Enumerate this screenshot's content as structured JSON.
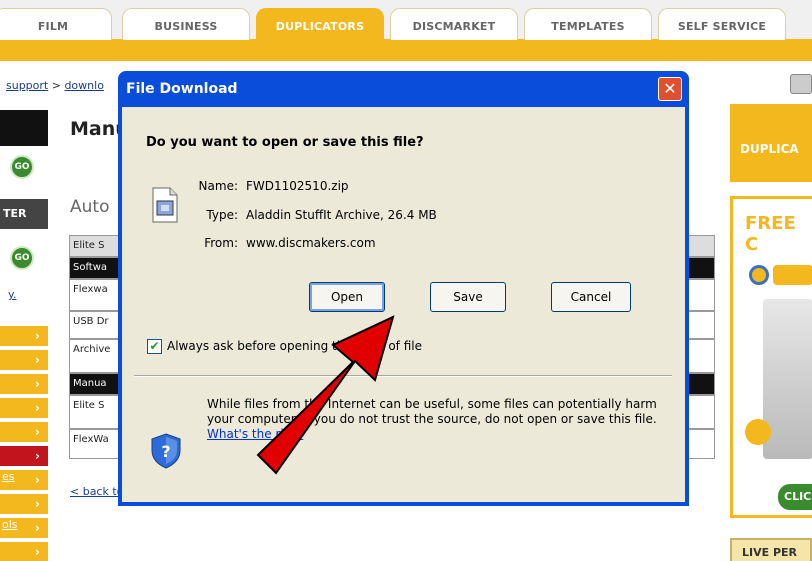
{
  "nav": {
    "tabs": [
      "FILM",
      "BUSINESS",
      "DUPLICATORS",
      "DISCMARKET",
      "TEMPLATES",
      "SELF SERVICE"
    ],
    "active_tab": "DUPLICATORS"
  },
  "breadcrumb": {
    "link1": "support",
    "sep": ">",
    "link2": "downlo"
  },
  "left_nav": {
    "go_label": "GO",
    "gray_label": "TER",
    "link_y": "y.",
    "link_es": "es",
    "link_ols": "ols",
    "arrow": "›"
  },
  "page": {
    "title": "Manu",
    "section": "Auto",
    "rows": [
      "Elite S",
      "Softwa",
      "Flexwa",
      "USB Dr",
      "Archive",
      "Manua",
      "Elite S",
      "FlexWa"
    ],
    "back_link": "< back to downloads main page"
  },
  "right": {
    "dup": "DUPLICA",
    "free": "FREE C",
    "click": "CLIC",
    "live": "LIVE PER"
  },
  "dialog": {
    "title": "File Download",
    "close": "✕",
    "question": "Do you want to open or save this file?",
    "name_label": "Name:",
    "name_value": "FWD1102510.zip",
    "type_label": "Type:",
    "type_value": "Aladdin StuffIt Archive, 26.4 MB",
    "from_label": "From:",
    "from_value": "www.discmakers.com",
    "open": "Open",
    "save": "Save",
    "cancel": "Cancel",
    "always_ask": "Always ask before opening this type of file",
    "always_ask_checked": true,
    "warning": "While files from the Internet can be useful, some files can potentially harm your computer. If you do not trust the source, do not open or save this file.",
    "risk_link": "What's the risk?"
  },
  "colors": {
    "accent": "#f3b81e",
    "dialog_title": "#0a4ddb",
    "dialog_body": "#ece9d8",
    "annotation_arrow": "#e00000"
  }
}
